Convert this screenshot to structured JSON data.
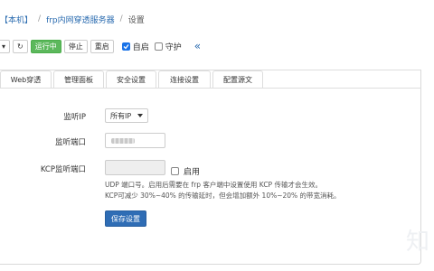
{
  "breadcrumb": {
    "items": [
      "【本机】",
      "frp内网穿透服务器",
      "设置"
    ]
  },
  "toolbar": {
    "dropdown_caret": "▾",
    "refresh_icon": "↻",
    "status_label": "运行中",
    "stop_label": "停止",
    "restart_label": "重启",
    "autostart_label": "自启",
    "autostart_checked": true,
    "guard_label": "守护",
    "guard_checked": false,
    "collapse_icon": "«"
  },
  "tabs": [
    "Web穿透",
    "管理面板",
    "安全设置",
    "连接设置",
    "配置源文"
  ],
  "form": {
    "listen_ip_label": "监听IP",
    "listen_ip_value": "所有IP",
    "listen_port_label": "监听端口",
    "kcp_port_label": "KCP监听端口",
    "kcp_enable_label": "启用",
    "kcp_enabled": false,
    "help_line1": "UDP 端口号。启用后需要在 frp 客户端中设置使用 KCP 传输才会生效。",
    "help_line2": "KCP可减少 30%~40% 的传输延时，但会增加额外 10%~20% 的带宽消耗。",
    "save_label": "保存设置"
  },
  "watermark": "知"
}
